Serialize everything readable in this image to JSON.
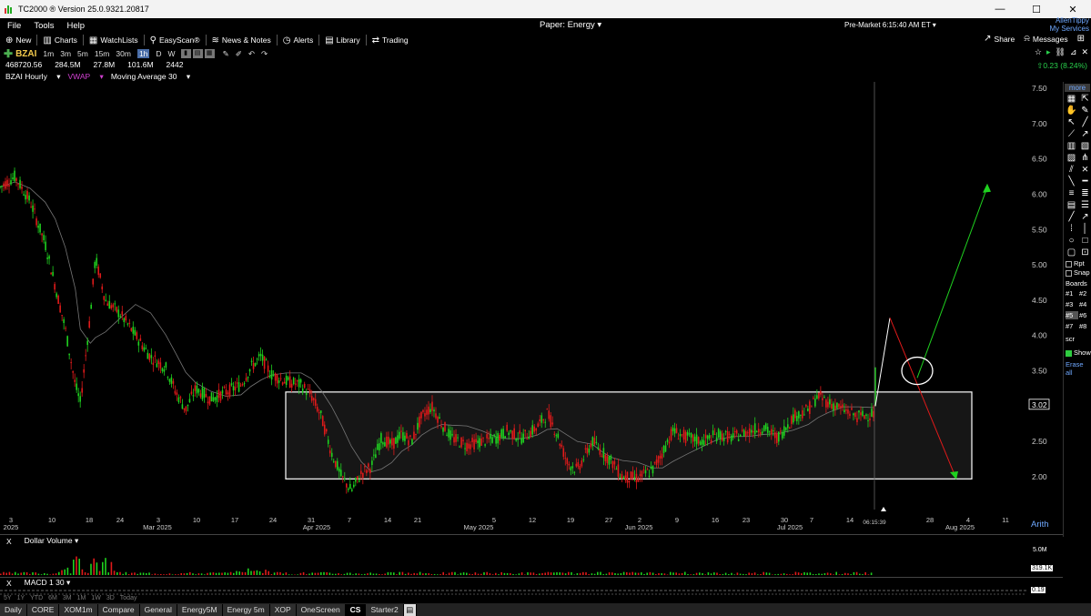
{
  "window": {
    "title": "TC2000 ® Version 25.0.9321.20817",
    "minimize": "—",
    "maximize": "☐",
    "close": "✕"
  },
  "menu": {
    "items": [
      "File",
      "Tools",
      "Help"
    ],
    "paper": "Paper: Energy ▾",
    "premarket": "Pre-Market 6:15:40 AM ET ▾",
    "user_name": "AllenTippy",
    "user_services": "My Services"
  },
  "toolbar": {
    "left": [
      {
        "icon": "⊕",
        "label": "New"
      },
      {
        "icon": "▥",
        "label": "Charts"
      },
      {
        "icon": "▦",
        "label": "WatchLists"
      },
      {
        "icon": "⚲",
        "label": "EasyScan®"
      },
      {
        "icon": "≋",
        "label": "News & Notes"
      },
      {
        "icon": "◷",
        "label": "Alerts"
      },
      {
        "icon": "▤",
        "label": "Library"
      },
      {
        "icon": "⇄",
        "label": "Trading"
      }
    ],
    "share": "Share",
    "messages": "Messages"
  },
  "symbol_row": {
    "symbol": "BZAI",
    "timeframes": [
      "1m",
      "3m",
      "5m",
      "15m",
      "30m",
      "1h",
      "D",
      "W"
    ],
    "active_timeframe": "1h"
  },
  "info": {
    "values": [
      "468720.56",
      "284.5M",
      "27.8M",
      "101.6M",
      "2442"
    ],
    "change": "0.23 (8.24%)"
  },
  "studies": {
    "chart_name": "BZAI Hourly",
    "vwap": "VWAP",
    "ma": "Moving Average 30"
  },
  "chart_data": {
    "type": "line",
    "price_axis": [
      "7.50",
      "7.00",
      "6.50",
      "6.00",
      "5.50",
      "5.00",
      "4.50",
      "4.00",
      "3.50",
      "3.00",
      "2.50",
      "2.00"
    ],
    "current_price": "3.02",
    "date_labels": [
      "3",
      "10",
      "18",
      "24",
      "3",
      "10",
      "17",
      "24",
      "31",
      "7",
      "14",
      "21",
      "5",
      "12",
      "19",
      "27",
      "2",
      "9",
      "16",
      "23",
      "30",
      "7",
      "14",
      "28",
      "4",
      "11"
    ],
    "month_labels": [
      "2025",
      "Mar 2025",
      "Apr 2025",
      "May 2025",
      "Jun 2025",
      "Jul 2025",
      "Aug 2025"
    ],
    "time_marker": "06:15:39",
    "scale_mode": "Arith",
    "ylim": [
      1.7,
      7.6
    ],
    "box_range": [
      1.97,
      3.2
    ],
    "price_path": [
      [
        0,
        6.1
      ],
      [
        3,
        6.25
      ],
      [
        6,
        5.9
      ],
      [
        9,
        5.3
      ],
      [
        11,
        4.7
      ],
      [
        13,
        4.1
      ],
      [
        15,
        3.3
      ],
      [
        16,
        3.05
      ],
      [
        18,
        4.3
      ],
      [
        19,
        5.1
      ],
      [
        21,
        4.5
      ],
      [
        24,
        4.3
      ],
      [
        27,
        4.0
      ],
      [
        30,
        3.7
      ],
      [
        33,
        3.55
      ],
      [
        35,
        3.2
      ],
      [
        37,
        2.95
      ],
      [
        39,
        3.25
      ],
      [
        42,
        3.1
      ],
      [
        45,
        3.2
      ],
      [
        48,
        3.3
      ],
      [
        50,
        3.55
      ],
      [
        52,
        3.7
      ],
      [
        54,
        3.45
      ],
      [
        57,
        3.35
      ],
      [
        60,
        3.3
      ],
      [
        62,
        3.15
      ],
      [
        64,
        2.85
      ],
      [
        66,
        2.35
      ],
      [
        68,
        2.0
      ],
      [
        70,
        1.8
      ],
      [
        72,
        2.05
      ],
      [
        74,
        2.15
      ],
      [
        76,
        2.55
      ],
      [
        78,
        2.45
      ],
      [
        80,
        2.6
      ],
      [
        82,
        2.5
      ],
      [
        84,
        2.85
      ],
      [
        86,
        3.0
      ],
      [
        88,
        2.75
      ],
      [
        90,
        2.55
      ],
      [
        93,
        2.45
      ],
      [
        96,
        2.5
      ],
      [
        99,
        2.55
      ],
      [
        101,
        2.65
      ],
      [
        104,
        2.55
      ],
      [
        107,
        2.7
      ],
      [
        109,
        2.9
      ],
      [
        111,
        2.6
      ],
      [
        113,
        2.2
      ],
      [
        115,
        2.1
      ],
      [
        118,
        2.5
      ],
      [
        120,
        2.35
      ],
      [
        122,
        2.2
      ],
      [
        124,
        2.0
      ],
      [
        127,
        1.98
      ],
      [
        130,
        2.1
      ],
      [
        132,
        2.35
      ],
      [
        134,
        2.65
      ],
      [
        137,
        2.55
      ],
      [
        140,
        2.5
      ],
      [
        143,
        2.6
      ],
      [
        146,
        2.55
      ],
      [
        149,
        2.65
      ],
      [
        152,
        2.7
      ],
      [
        155,
        2.55
      ],
      [
        158,
        2.85
      ],
      [
        161,
        2.95
      ],
      [
        163,
        3.15
      ],
      [
        165,
        3.05
      ],
      [
        168,
        2.95
      ],
      [
        171,
        2.85
      ],
      [
        174,
        2.9
      ]
    ],
    "annotations": {
      "projection_up_target": 6.1,
      "projection_down_target": 2.0,
      "spike_high": 4.25
    }
  },
  "panes": {
    "volume": "Dollar Volume",
    "volume_axis": "5.0M",
    "volume_last": "319.1K",
    "macd": "MACD 1 30",
    "macd_last": "0.19"
  },
  "range_buttons": [
    "5Y",
    "1Y",
    "YTD",
    "6M",
    "3M",
    "1M",
    "1W",
    "3D",
    "Today"
  ],
  "sidebar": {
    "more": "more",
    "rpt": "Rpt",
    "snap": "Snap",
    "boards_title": "Boards",
    "boards": [
      "#1",
      "#2",
      "#3",
      "#4",
      "#5",
      "#6",
      "#7",
      "#8"
    ],
    "selected_board": "#5",
    "scr": "scr",
    "show": "Show",
    "erase": "Erase all"
  },
  "tabs": [
    "Daily",
    "CORE",
    "XOM1m",
    "Compare",
    "General",
    "Energy5M",
    "Energy 5m",
    "XOP",
    "OneScreen",
    "CS",
    "Starter2"
  ],
  "active_tab": "CS",
  "colors": {
    "up": "#1fd11f",
    "down": "#e01a1a",
    "box": "#ffffff",
    "link": "#6fa8ff"
  }
}
